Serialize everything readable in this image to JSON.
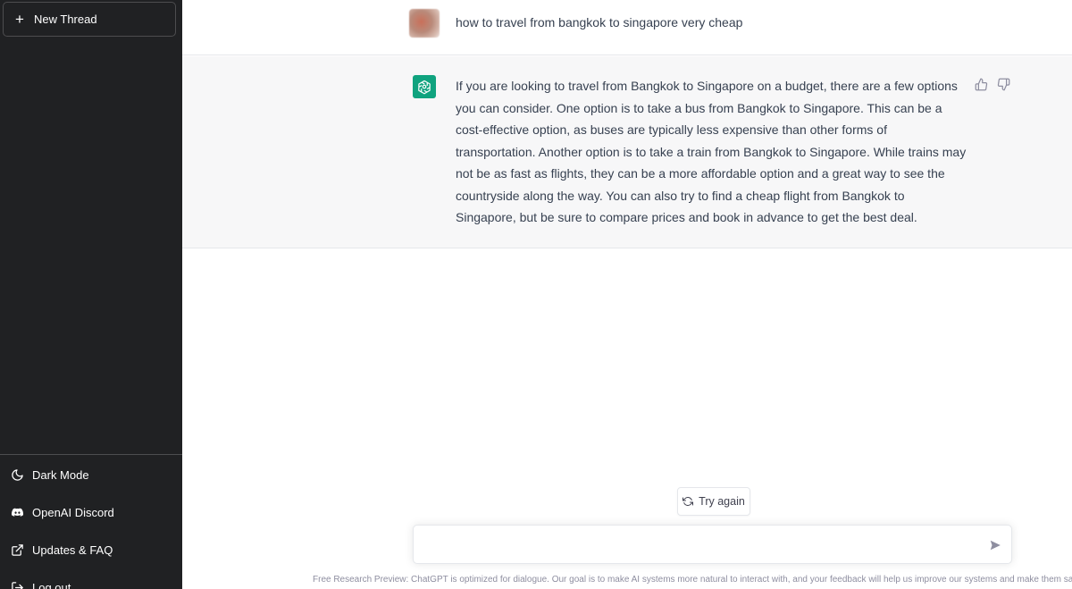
{
  "sidebar": {
    "new_thread_label": "New Thread",
    "items": [
      {
        "label": "Dark Mode",
        "icon": "moon-icon"
      },
      {
        "label": "OpenAI Discord",
        "icon": "discord-icon"
      },
      {
        "label": "Updates & FAQ",
        "icon": "external-link-icon"
      },
      {
        "label": "Log out",
        "icon": "logout-icon"
      }
    ]
  },
  "conversation": {
    "user_message": "how to travel from bangkok to singapore very cheap",
    "assistant_message": "If you are looking to travel from Bangkok to Singapore on a budget, there are a few options you can consider. One option is to take a bus from Bangkok to Singapore. This can be a cost-effective option, as buses are typically less expensive than other forms of transportation. Another option is to take a train from Bangkok to Singapore. While trains may not be as fast as flights, they can be a more affordable option and a great way to see the countryside along the way. You can also try to find a cheap flight from Bangkok to Singapore, but be sure to compare prices and book in advance to get the best deal."
  },
  "actions": {
    "try_again_label": "Try again"
  },
  "composer": {
    "value": "",
    "placeholder": ""
  },
  "footer": {
    "note": "Free Research Preview: ChatGPT is optimized for dialogue. Our goal is to make AI systems more natural to interact with, and your feedback will help us improve our systems and make them safer."
  },
  "colors": {
    "sidebar_bg": "#202123",
    "assistant_row_bg": "#f7f7f8",
    "brand_green": "#10a37f"
  }
}
